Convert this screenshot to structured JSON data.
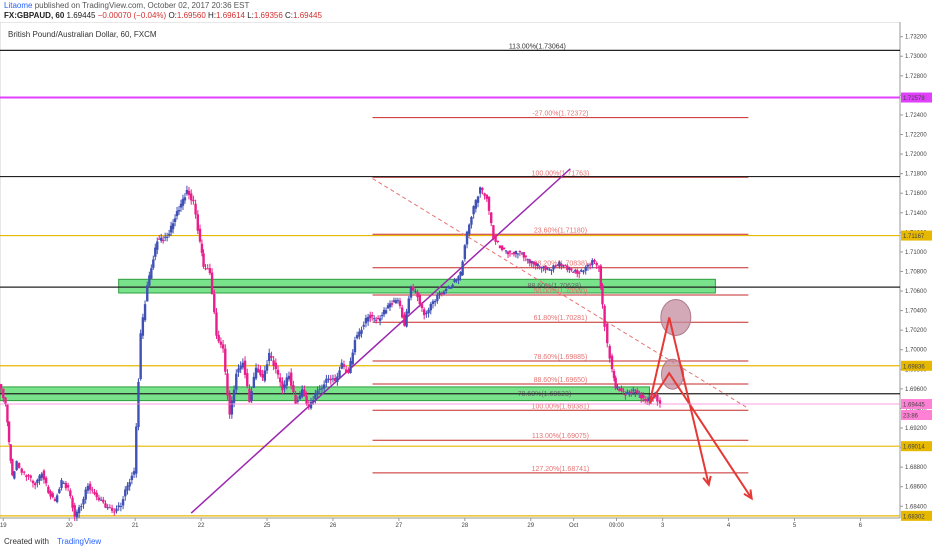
{
  "header": {
    "author": "Litaome",
    "published_text": "published on TradingView.com, October 02, 2017 20:36 EST",
    "symbol": "FX:GBPAUD, 60",
    "price": "1.69445",
    "change": "−0.00070 (−0.04%)",
    "o_label": "O:",
    "o_value": "1.69560",
    "h_label": "H:",
    "h_value": "1.69614",
    "l_label": "L:",
    "l_value": "1.69356",
    "c_label": "C:",
    "c_value": "1.69445"
  },
  "chart_title": "British Pound/Australian Dollar, 60, FXCM",
  "footer": {
    "created_with": "Created with",
    "brand": "TradingView"
  },
  "chart_data": {
    "type": "candlestick",
    "title": "British Pound/Australian Dollar, 60, FXCM",
    "ylim": [
      1.6828,
      1.7335
    ],
    "y_ticks": [
      1.732,
      1.73,
      1.728,
      1.726,
      1.724,
      1.722,
      1.72,
      1.718,
      1.716,
      1.714,
      1.712,
      1.71,
      1.708,
      1.706,
      1.704,
      1.702,
      1.7,
      1.698,
      1.696,
      1.694,
      1.692,
      1.69,
      1.688,
      1.686,
      1.684
    ],
    "x_labels": [
      {
        "label": "19",
        "x": 0
      },
      {
        "label": "20",
        "x": 1
      },
      {
        "label": "21",
        "x": 2
      },
      {
        "label": "22",
        "x": 3
      },
      {
        "label": "25",
        "x": 4
      },
      {
        "label": "26",
        "x": 5
      },
      {
        "label": "27",
        "x": 6
      },
      {
        "label": "28",
        "x": 7
      },
      {
        "label": "29",
        "x": 8
      },
      {
        "label": "Oct",
        "x": 8.65
      },
      {
        "label": "09:00",
        "x": 9.3
      },
      {
        "label": "3",
        "x": 10
      },
      {
        "label": "4",
        "x": 11
      },
      {
        "label": "5",
        "x": 12
      },
      {
        "label": "6",
        "x": 13
      }
    ],
    "xlim": [
      -0.05,
      13.6
    ],
    "price_path": [
      [
        -0.05,
        1.6965
      ],
      [
        0.05,
        1.6945
      ],
      [
        0.1,
        1.6905
      ],
      [
        0.15,
        1.687
      ],
      [
        0.22,
        1.6885
      ],
      [
        0.3,
        1.6875
      ],
      [
        0.4,
        1.687
      ],
      [
        0.5,
        1.6862
      ],
      [
        0.6,
        1.6875
      ],
      [
        0.7,
        1.6855
      ],
      [
        0.8,
        1.6845
      ],
      [
        0.9,
        1.6865
      ],
      [
        1.0,
        1.6858
      ],
      [
        1.1,
        1.683
      ],
      [
        1.2,
        1.6842
      ],
      [
        1.3,
        1.6862
      ],
      [
        1.4,
        1.6852
      ],
      [
        1.5,
        1.6845
      ],
      [
        1.6,
        1.6838
      ],
      [
        1.7,
        1.6835
      ],
      [
        1.8,
        1.6842
      ],
      [
        1.9,
        1.6862
      ],
      [
        2.0,
        1.6875
      ],
      [
        2.1,
        1.7015
      ],
      [
        2.2,
        1.7065
      ],
      [
        2.35,
        1.7112
      ],
      [
        2.5,
        1.7115
      ],
      [
        2.65,
        1.714
      ],
      [
        2.8,
        1.7162
      ],
      [
        2.9,
        1.715
      ],
      [
        3.0,
        1.711
      ],
      [
        3.05,
        1.7085
      ],
      [
        3.15,
        1.708
      ],
      [
        3.25,
        1.7015
      ],
      [
        3.35,
        1.7
      ],
      [
        3.45,
        1.6932
      ],
      [
        3.55,
        1.6975
      ],
      [
        3.65,
        1.6988
      ],
      [
        3.75,
        1.6948
      ],
      [
        3.85,
        1.6982
      ],
      [
        3.95,
        1.697
      ],
      [
        4.05,
        1.6995
      ],
      [
        4.15,
        1.698
      ],
      [
        4.25,
        1.696
      ],
      [
        4.35,
        1.6975
      ],
      [
        4.45,
        1.6945
      ],
      [
        4.55,
        1.6958
      ],
      [
        4.65,
        1.694
      ],
      [
        4.75,
        1.6955
      ],
      [
        4.85,
        1.6962
      ],
      [
        4.95,
        1.6972
      ],
      [
        5.05,
        1.6968
      ],
      [
        5.15,
        1.6985
      ],
      [
        5.25,
        1.6975
      ],
      [
        5.35,
        1.701
      ],
      [
        5.45,
        1.7022
      ],
      [
        5.55,
        1.7035
      ],
      [
        5.7,
        1.703
      ],
      [
        5.85,
        1.7045
      ],
      [
        6.0,
        1.7052
      ],
      [
        6.1,
        1.7025
      ],
      [
        6.2,
        1.7065
      ],
      [
        6.3,
        1.7055
      ],
      [
        6.4,
        1.7035
      ],
      [
        6.5,
        1.7045
      ],
      [
        6.6,
        1.7055
      ],
      [
        6.7,
        1.706
      ],
      [
        6.8,
        1.7065
      ],
      [
        6.95,
        1.7078
      ],
      [
        7.05,
        1.712
      ],
      [
        7.15,
        1.7145
      ],
      [
        7.25,
        1.7165
      ],
      [
        7.35,
        1.7155
      ],
      [
        7.45,
        1.7115
      ],
      [
        7.55,
        1.7105
      ],
      [
        7.7,
        1.7098
      ],
      [
        7.85,
        1.71
      ],
      [
        8.0,
        1.709
      ],
      [
        8.15,
        1.7085
      ],
      [
        8.3,
        1.7082
      ],
      [
        8.45,
        1.7088
      ],
      [
        8.6,
        1.7082
      ],
      [
        8.75,
        1.7078
      ],
      [
        8.95,
        1.709
      ],
      [
        9.05,
        1.7085
      ],
      [
        9.1,
        1.7045
      ],
      [
        9.18,
        1.7005
      ],
      [
        9.25,
        1.698
      ],
      [
        9.3,
        1.6962
      ],
      [
        9.45,
        1.6955
      ],
      [
        9.6,
        1.6958
      ],
      [
        9.75,
        1.6948
      ],
      [
        9.9,
        1.6952
      ],
      [
        9.98,
        1.6945
      ]
    ],
    "horizontal_lines": [
      {
        "price": 1.7306,
        "color": "#222222",
        "width": 1.2,
        "label": "113.00%(1.73064)",
        "label_x": 8.1
      },
      {
        "price": 1.72578,
        "color": "#e040fb",
        "width": 2,
        "label": "",
        "price_tag": "1.72578"
      },
      {
        "price": 1.7177,
        "color": "#222222",
        "width": 1.2,
        "label": ""
      },
      {
        "price": 1.71167,
        "color": "#e6b800",
        "width": 1.2,
        "label": "",
        "price_tag": "1.71167"
      },
      {
        "price": 1.7064,
        "color": "#222222",
        "width": 1.2,
        "label": ""
      },
      {
        "price": 1.69836,
        "color": "#e6b800",
        "width": 1.2,
        "label": "",
        "price_tag": "1.69836"
      },
      {
        "price": 1.6955,
        "color": "#222222",
        "width": 1.2,
        "label": ""
      },
      {
        "price": 1.69014,
        "color": "#e6b800",
        "width": 1.2,
        "label": "",
        "price_tag": "1.69014"
      },
      {
        "price": 1.68302,
        "color": "#e6b800",
        "width": 1.2,
        "label": "",
        "price_tag": "1.68302"
      }
    ],
    "fib_levels": [
      {
        "label": "-27.00%(1.72372)",
        "price": 1.72372
      },
      {
        "label": "100.00%(1.71763)",
        "price": 1.71763
      },
      {
        "label": "23.60%(1.71180)",
        "price": 1.7118
      },
      {
        "label": "38.20%(1.70838)",
        "price": 1.70838
      },
      {
        "label": "50.00%(1.70560)",
        "price": 1.7056
      },
      {
        "label": "61.80%(1.70281)",
        "price": 1.70281
      },
      {
        "label": "78.60%(1.69885)",
        "price": 1.69885
      },
      {
        "label": "88.60%(1.69650)",
        "price": 1.6965
      },
      {
        "label": "100.00%(1.69381)",
        "price": 1.69381
      },
      {
        "label": "113.00%(1.69075)",
        "price": 1.69075
      },
      {
        "label": "127.20%(1.68741)",
        "price": 1.68741
      }
    ],
    "fib_x_range": [
      5.6,
      11.3
    ],
    "green_zones": [
      {
        "x0": 1.75,
        "x1": 10.8,
        "y0": 1.7058,
        "y1": 1.7072,
        "label": "88.60%(1.70628)",
        "label_x": 7.95
      },
      {
        "x0": -0.05,
        "x1": 9.8,
        "y0": 1.6948,
        "y1": 1.6962,
        "label": "78.60%(1.69523)",
        "label_x": 7.8
      }
    ],
    "trendline": {
      "x0": 2.85,
      "y0": 1.6833,
      "x1": 8.6,
      "y1": 1.7185,
      "color": "#9c27b0"
    },
    "dashed_line": {
      "x0": 5.6,
      "y0": 1.7175,
      "x1": 11.3,
      "y1": 1.694,
      "color": "#e57373"
    },
    "ellipses": [
      {
        "x": 10.2,
        "price": 1.7033,
        "rx": 15,
        "ry": 18
      },
      {
        "x": 10.15,
        "price": 1.6975,
        "rx": 11,
        "ry": 15
      }
    ],
    "arrows": [
      {
        "points": [
          [
            9.8,
            1.6945
          ],
          [
            10.1,
            1.7033
          ],
          [
            10.7,
            1.6862
          ]
        ]
      },
      {
        "points": [
          [
            9.8,
            1.6945
          ],
          [
            10.1,
            1.6976
          ],
          [
            11.35,
            1.6848
          ]
        ]
      }
    ],
    "current_price": {
      "price": 1.69445,
      "tag": "1.69445",
      "timer": "23:86"
    }
  }
}
